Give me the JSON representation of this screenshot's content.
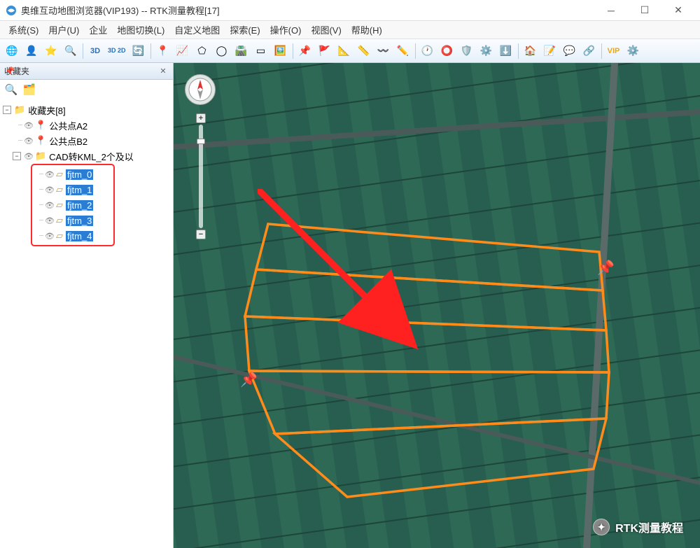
{
  "window": {
    "title": "奥维互动地图浏览器(VIP193) -- RTK测量教程[17]"
  },
  "menu": {
    "system": "系统(S)",
    "user": "用户(U)",
    "enterprise": "企业",
    "mapswitch": "地图切换(L)",
    "custommap": "自定义地图",
    "explore": "探索(E)",
    "operate": "操作(O)",
    "view": "视图(V)",
    "help": "帮助(H)"
  },
  "toolbar": {
    "d3": "3D",
    "d2": "3D 2D",
    "vip": "VIP"
  },
  "sidebar": {
    "title": "收藏夹",
    "root": "收藏夹[8]",
    "items": {
      "a2": "公共点A2",
      "b2": "公共点B2",
      "cad": "CAD转KML_2个及以"
    },
    "shapes": [
      "fjtm_0",
      "fjtm_1",
      "fjtm_2",
      "fjtm_3",
      "fjtm_4"
    ]
  },
  "watermark": {
    "text": "RTK测量教程"
  },
  "map": {
    "overlay_color": "#ff8c1a",
    "highlight_box_color": "#ff2a2a"
  }
}
